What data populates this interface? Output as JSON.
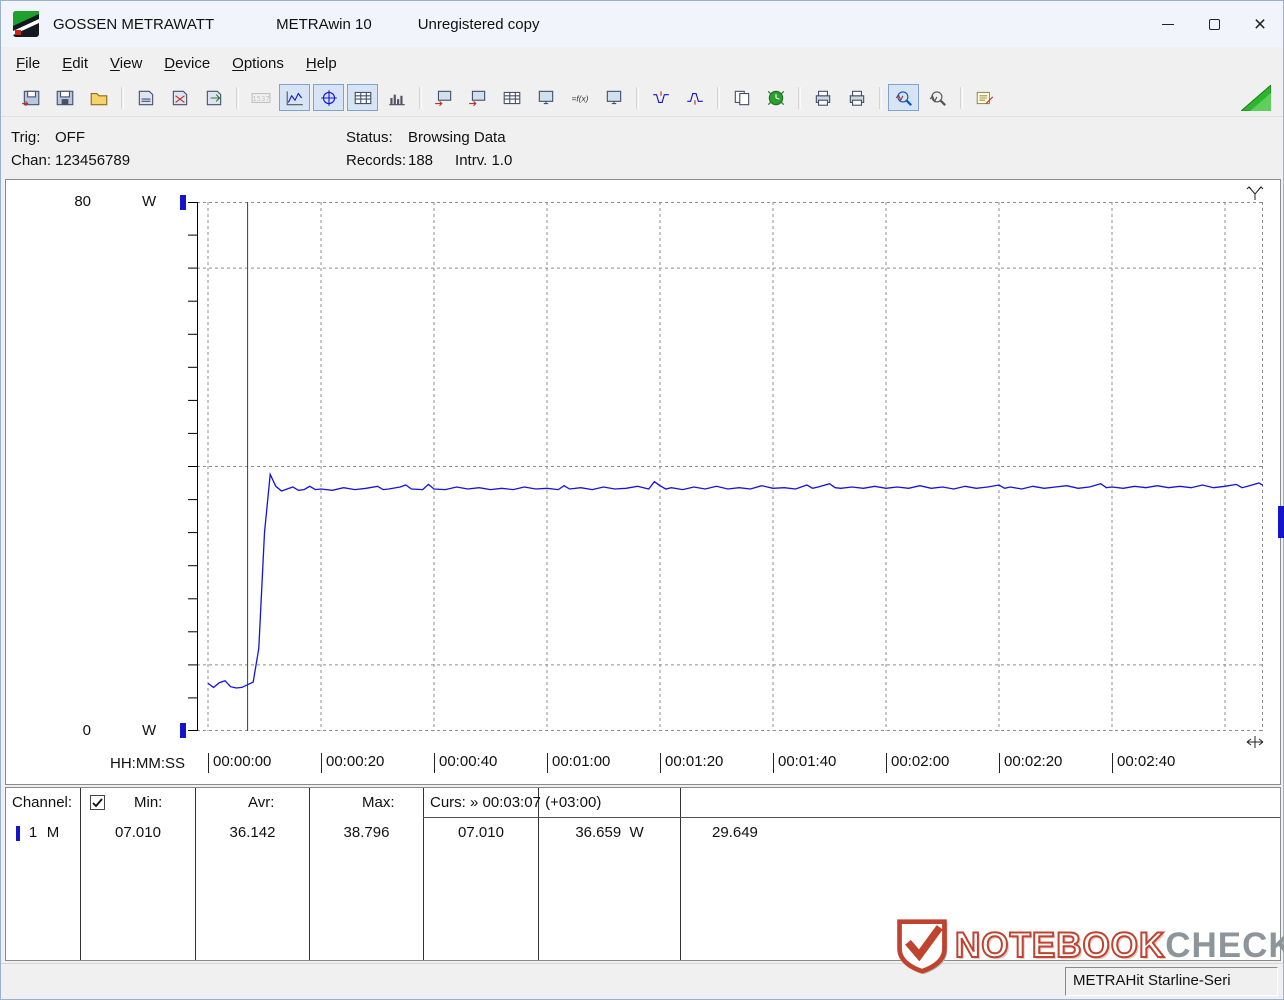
{
  "titlebar": {
    "brand": "GOSSEN METRAWATT",
    "app": "METRAwin 10",
    "license": "Unregistered copy"
  },
  "menu": {
    "items": [
      "File",
      "Edit",
      "View",
      "Device",
      "Options",
      "Help"
    ]
  },
  "toolbar": {
    "items": [
      {
        "name": "open-data-window",
        "icon": "disk-arrow"
      },
      {
        "name": "save-file",
        "icon": "disk"
      },
      {
        "name": "open-file",
        "icon": "folder"
      },
      {
        "sep": true
      },
      {
        "name": "card-read",
        "icon": "card"
      },
      {
        "name": "card-erase",
        "icon": "card-x"
      },
      {
        "name": "card-export",
        "icon": "card-out"
      },
      {
        "sep": true
      },
      {
        "name": "numeric-display",
        "icon": "numeric",
        "disabled": true
      },
      {
        "name": "trend-view",
        "icon": "trend",
        "active": true
      },
      {
        "name": "cursor-view",
        "icon": "crosshair",
        "active": true
      },
      {
        "name": "table-view",
        "icon": "table",
        "active": true
      },
      {
        "name": "histogram-view",
        "icon": "histogram"
      },
      {
        "sep": true
      },
      {
        "name": "device-settings",
        "icon": "screen-arrow"
      },
      {
        "name": "device-read",
        "icon": "screen-arrow"
      },
      {
        "name": "device-program",
        "icon": "table"
      },
      {
        "name": "device-monitor",
        "icon": "monitor"
      },
      {
        "name": "formula-fx",
        "icon": "fx"
      },
      {
        "name": "pc-display",
        "icon": "monitor"
      },
      {
        "sep": true
      },
      {
        "name": "envelope-min",
        "icon": "wave-min"
      },
      {
        "name": "envelope-max",
        "icon": "wave-max"
      },
      {
        "sep": true
      },
      {
        "name": "copy-clipboard",
        "icon": "copy"
      },
      {
        "name": "timer-record",
        "icon": "timer"
      },
      {
        "sep": true
      },
      {
        "name": "print",
        "icon": "printer"
      },
      {
        "name": "print-report",
        "icon": "printer"
      },
      {
        "sep": true
      },
      {
        "name": "zoom-time",
        "icon": "zoom",
        "active": true
      },
      {
        "name": "zoom-amplitude",
        "icon": "zoom2"
      },
      {
        "sep": true
      },
      {
        "name": "comment-note",
        "icon": "note"
      }
    ]
  },
  "info": {
    "trig_label": "Trig:",
    "trig_value": "OFF",
    "chan_label": "Chan:",
    "chan_value": "123456789",
    "status_label": "Status:",
    "status_value": "Browsing Data",
    "records_label": "Records:",
    "records_value": "188",
    "intrv_label": "Intrv.",
    "intrv_value": "1.0"
  },
  "axis": {
    "y_top": "80",
    "y_bottom": "0",
    "y_unit": "W",
    "x_title": "HH:MM:SS"
  },
  "chart_data": {
    "type": "line",
    "title": "",
    "xlabel": "HH:MM:SS",
    "ylabel": "W",
    "ylim": [
      0,
      80
    ],
    "y_tick_step": 5,
    "y_gridlines": [
      10,
      40,
      70
    ],
    "x_grid_step_s": 20,
    "x_end_s": 187,
    "grid": true,
    "x_ticks": [
      "00:00:00",
      "00:00:20",
      "00:00:40",
      "00:01:00",
      "00:01:20",
      "00:01:40",
      "00:02:00",
      "00:02:20",
      "00:02:40"
    ],
    "cursor1": {
      "time_s": 7,
      "value": 7.01
    },
    "cursor2": {
      "time_label": "00:03:07",
      "value": 36.659
    },
    "stats": {
      "min": 7.01,
      "avr": 36.142,
      "max": 38.796,
      "records": 188,
      "interval_s": 1.0
    },
    "series": [
      {
        "name": "Channel 1",
        "unit": "W",
        "color": "#1414dd",
        "points": [
          [
            0,
            7.2
          ],
          [
            1,
            6.6
          ],
          [
            2,
            7.3
          ],
          [
            3,
            7.6
          ],
          [
            4,
            6.7
          ],
          [
            5,
            6.5
          ],
          [
            6,
            6.6
          ],
          [
            7,
            7.0
          ],
          [
            8,
            7.4
          ],
          [
            9,
            12.5
          ],
          [
            10,
            30.0
          ],
          [
            11,
            38.8
          ],
          [
            12,
            37.0
          ],
          [
            13,
            36.3
          ],
          [
            14,
            36.6
          ],
          [
            15,
            36.9
          ],
          [
            16,
            36.4
          ],
          [
            17,
            36.5
          ],
          [
            18,
            37.0
          ],
          [
            19,
            36.5
          ],
          [
            20,
            36.6
          ],
          [
            22,
            36.4
          ],
          [
            24,
            36.8
          ],
          [
            26,
            36.5
          ],
          [
            28,
            36.7
          ],
          [
            30,
            37.0
          ],
          [
            31,
            36.5
          ],
          [
            32,
            36.6
          ],
          [
            34,
            36.9
          ],
          [
            35,
            37.2
          ],
          [
            36,
            36.6
          ],
          [
            38,
            36.5
          ],
          [
            39,
            37.3
          ],
          [
            40,
            36.6
          ],
          [
            42,
            36.5
          ],
          [
            44,
            36.9
          ],
          [
            46,
            36.6
          ],
          [
            48,
            36.8
          ],
          [
            50,
            36.5
          ],
          [
            52,
            36.7
          ],
          [
            54,
            36.5
          ],
          [
            56,
            36.9
          ],
          [
            58,
            36.6
          ],
          [
            60,
            36.7
          ],
          [
            62,
            36.5
          ],
          [
            63,
            37.1
          ],
          [
            64,
            36.6
          ],
          [
            66,
            36.8
          ],
          [
            68,
            36.5
          ],
          [
            70,
            36.9
          ],
          [
            72,
            36.6
          ],
          [
            74,
            36.7
          ],
          [
            76,
            37.0
          ],
          [
            78,
            36.6
          ],
          [
            79,
            37.7
          ],
          [
            80,
            37.1
          ],
          [
            81,
            36.6
          ],
          [
            82,
            36.8
          ],
          [
            84,
            36.5
          ],
          [
            86,
            36.9
          ],
          [
            88,
            36.6
          ],
          [
            90,
            37.0
          ],
          [
            92,
            36.6
          ],
          [
            94,
            36.8
          ],
          [
            96,
            36.6
          ],
          [
            98,
            37.1
          ],
          [
            100,
            36.7
          ],
          [
            102,
            36.8
          ],
          [
            104,
            36.6
          ],
          [
            106,
            37.2
          ],
          [
            107,
            36.7
          ],
          [
            108,
            36.9
          ],
          [
            110,
            37.4
          ],
          [
            111,
            36.8
          ],
          [
            112,
            36.7
          ],
          [
            114,
            36.9
          ],
          [
            116,
            36.7
          ],
          [
            118,
            37.0
          ],
          [
            120,
            36.7
          ],
          [
            122,
            36.9
          ],
          [
            124,
            36.7
          ],
          [
            126,
            37.1
          ],
          [
            128,
            36.7
          ],
          [
            130,
            36.9
          ],
          [
            132,
            36.6
          ],
          [
            134,
            37.0
          ],
          [
            136,
            36.7
          ],
          [
            138,
            36.9
          ],
          [
            140,
            37.2
          ],
          [
            141,
            36.7
          ],
          [
            142,
            36.9
          ],
          [
            144,
            36.6
          ],
          [
            146,
            37.0
          ],
          [
            148,
            36.7
          ],
          [
            150,
            36.9
          ],
          [
            152,
            37.1
          ],
          [
            154,
            36.7
          ],
          [
            156,
            36.9
          ],
          [
            158,
            37.4
          ],
          [
            159,
            36.8
          ],
          [
            160,
            36.9
          ],
          [
            162,
            36.7
          ],
          [
            164,
            37.0
          ],
          [
            166,
            36.8
          ],
          [
            168,
            37.1
          ],
          [
            170,
            36.8
          ],
          [
            172,
            37.0
          ],
          [
            174,
            36.8
          ],
          [
            176,
            37.2
          ],
          [
            178,
            36.8
          ],
          [
            180,
            37.0
          ],
          [
            182,
            37.3
          ],
          [
            183,
            36.8
          ],
          [
            184,
            37.0
          ],
          [
            186,
            37.5
          ],
          [
            187,
            37.0
          ]
        ]
      }
    ]
  },
  "table": {
    "header": {
      "channel": "Channel:",
      "checkbox_checked": true,
      "min": "Min:",
      "avr": "Avr:",
      "max": "Max:",
      "curs": "Curs: » 00:03:07 (+03:00)"
    },
    "row": {
      "channel": "1",
      "mode": "M",
      "min": "07.010",
      "avr": "36.142",
      "max": "38.796",
      "curs1": "07.010",
      "curs2": "36.659  W",
      "delta": "29.649"
    }
  },
  "watermark": {
    "primary": "NOTEBOOK",
    "secondary": "CHECK"
  },
  "status_bar": {
    "device_text": "METRAHit Starline-Seri"
  }
}
